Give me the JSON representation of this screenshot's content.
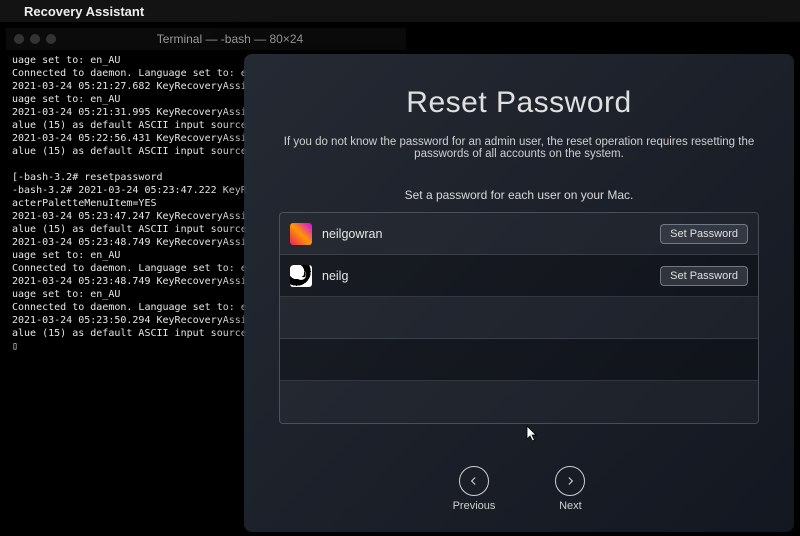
{
  "menubar": {
    "app_name": "Recovery Assistant"
  },
  "terminal": {
    "title": "Terminal — -bash — 80×24",
    "lines": [
      "uage set to: en_AU",
      "Connected to daemon. Language set to: e",
      "2021-03-24 05:21:27.682 KeyRecoveryAssi",
      "uage set to: en_AU",
      "2021-03-24 05:21:31.995 KeyRecoveryAssi",
      "alue (15) as default ASCII input source",
      "2021-03-24 05:22:56.431 KeyRecoveryAssi",
      "alue (15) as default ASCII input source",
      "",
      "[-bash-3.2# resetpassword",
      "-bash-3.2# 2021-03-24 05:23:47.222 KeyR",
      "acterPaletteMenuItem=YES",
      "2021-03-24 05:23:47.247 KeyRecoveryAssi",
      "alue (15) as default ASCII input source",
      "2021-03-24 05:23:48.749 KeyRecoveryAssi",
      "uage set to: en_AU",
      "Connected to daemon. Language set to: e",
      "2021-03-24 05:23:48.749 KeyRecoveryAssi",
      "uage set to: en_AU",
      "Connected to daemon. Language set to: e",
      "2021-03-24 05:23:50.294 KeyRecoveryAssi",
      "alue (15) as default ASCII input source",
      "▯"
    ]
  },
  "reset": {
    "title": "Reset Password",
    "desc": "If you do not know the password for an admin user, the reset operation requires resetting the passwords of all accounts on the system.",
    "subhead": "Set a password for each user on your Mac.",
    "users": [
      {
        "name": "neilgowran",
        "button": "Set Password"
      },
      {
        "name": "neilg",
        "button": "Set Password"
      }
    ],
    "nav": {
      "prev": "Previous",
      "next": "Next"
    }
  }
}
